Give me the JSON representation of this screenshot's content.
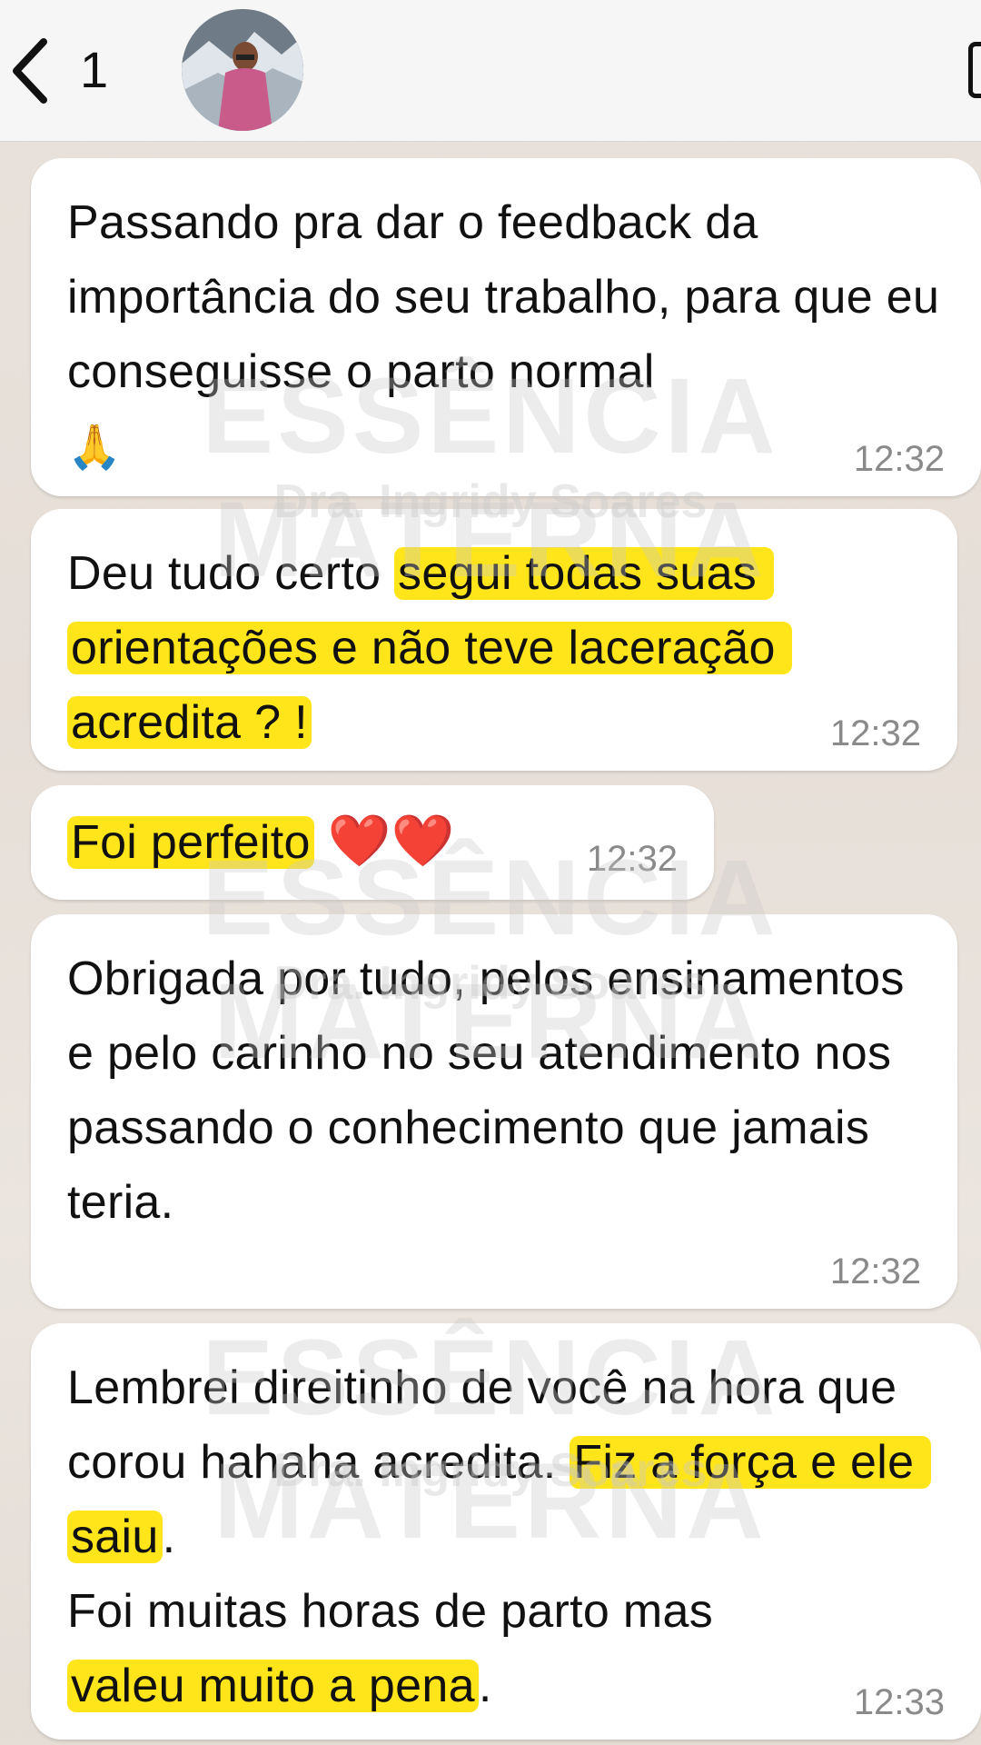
{
  "header": {
    "back_icon": "chevron-left-icon",
    "unread_count": "1",
    "avatar": "contact-avatar"
  },
  "messages": [
    {
      "parts": [
        "Passando pra dar o feedback da importância do seu trabalho, para que eu conseguisse o parto normal",
        "🙏"
      ],
      "time": "12:32"
    },
    {
      "parts": [
        "Deu tudo certo ",
        "segui todas suas orientações e não teve laceração acredita ? !"
      ],
      "time": "12:32"
    },
    {
      "parts": [
        "Foi perfeito",
        "❤️❤️"
      ],
      "time": "12:32"
    },
    {
      "parts": [
        "Obrigada por tudo, pelos ensinamentos e pelo carinho no seu atendimento nos passando o conhecimento que jamais teria."
      ],
      "time": "12:32"
    },
    {
      "parts": [
        "Lembrei direitinho de você na hora que corou hahaha acredita. ",
        "Fiz a força e ele saiu",
        ".",
        "Foi muitas horas de parto mas",
        "valeu muito a pena",
        "."
      ],
      "time": "12:33"
    }
  ],
  "watermark": {
    "brand": "ESSÊNCIA MATERNA",
    "subtitle": "Dra. Ingridy Soares"
  },
  "colors": {
    "highlight": "#ffe51a",
    "bubble": "#ffffff",
    "time": "#8a8a8a"
  }
}
